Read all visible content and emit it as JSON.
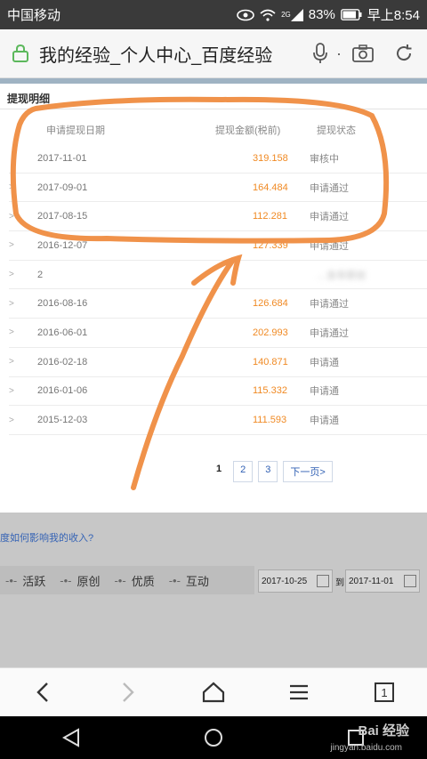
{
  "status_bar": {
    "carrier": "中国移动",
    "network": "2G",
    "battery": "83%",
    "time": "早上8:54"
  },
  "browser": {
    "page_title": "我的经验_个人中心_百度经验",
    "dot": "·"
  },
  "section": {
    "title": "提现明细"
  },
  "table": {
    "headers": {
      "date": "申请提现日期",
      "amount": "提现金额(税前)",
      "status": "提现状态"
    },
    "rows": [
      {
        "chev": "",
        "date": "2017-11-01",
        "amount": "319.158",
        "status": "审核中"
      },
      {
        "chev": ">",
        "date": "2017-09-01",
        "amount": "164.484",
        "status": "申请通过"
      },
      {
        "chev": ">",
        "date": "2017-08-15",
        "amount": "112.281",
        "status": "申请通过"
      },
      {
        "chev": ">",
        "date": "2016-12-07",
        "amount": "127.339",
        "status": "申请通过"
      },
      {
        "chev": ">",
        "date": "2",
        "amount": "",
        "status": "…含非原创"
      },
      {
        "chev": ">",
        "date": "2016-08-16",
        "amount": "126.684",
        "status": "申请通过"
      },
      {
        "chev": ">",
        "date": "2016-06-01",
        "amount": "202.993",
        "status": "申请通过"
      },
      {
        "chev": ">",
        "date": "2016-02-18",
        "amount": "140.871",
        "status": "申请通"
      },
      {
        "chev": ">",
        "date": "2016-01-06",
        "amount": "115.332",
        "status": "申请通"
      },
      {
        "chev": ">",
        "date": "2015-12-03",
        "amount": "111.593",
        "status": "申请通"
      }
    ]
  },
  "pager": {
    "current": "1",
    "page2": "2",
    "page3": "3",
    "next": "下一页>"
  },
  "lower": {
    "faq": "度如何影响我的收入?",
    "filters": [
      "活跃",
      "原创",
      "优质",
      "互动"
    ],
    "date_from": "2017-10-25",
    "to": "到",
    "date_to": "2017-11-01"
  },
  "watermark": {
    "brand": "Bai 经验",
    "url": "jingyan.baidu.com"
  },
  "colors": {
    "amount": "#f08a24",
    "annotation": "#f0924a",
    "link": "#3563b5",
    "status_bar": "#3a3a3a"
  }
}
